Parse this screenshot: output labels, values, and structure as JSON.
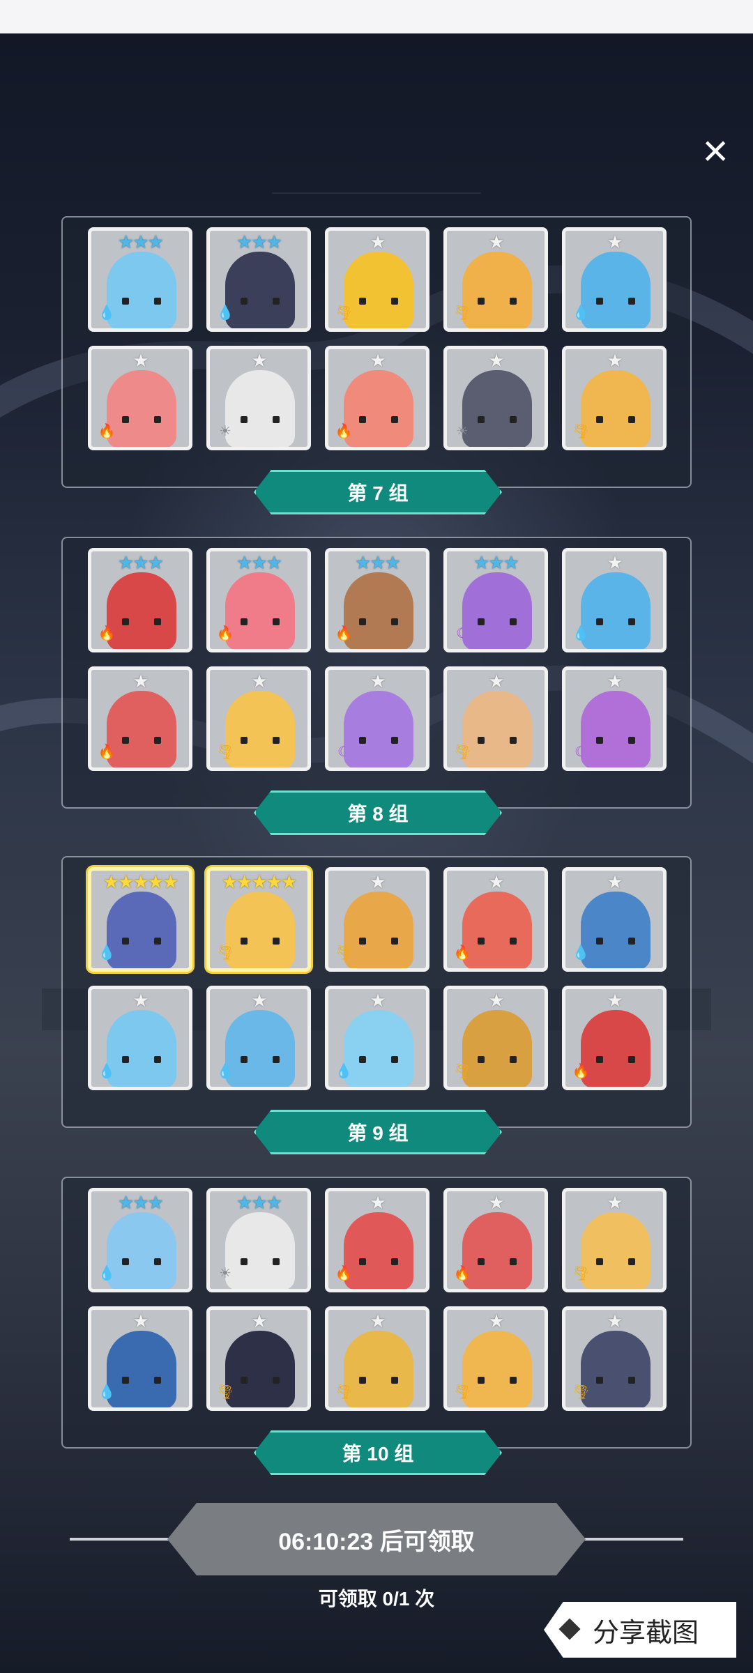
{
  "close_icon": "×",
  "groups": [
    {
      "label": "第 7 组",
      "cards": [
        {
          "stars": "★★★",
          "tier": "blue",
          "element": "water",
          "hair": "#7cc8ef"
        },
        {
          "stars": "★★★",
          "tier": "blue",
          "element": "water",
          "hair": "#3b3f5a"
        },
        {
          "stars": "★",
          "tier": "silver",
          "element": "wind",
          "hair": "#f3c232"
        },
        {
          "stars": "★",
          "tier": "silver",
          "element": "wind",
          "hair": "#f0b14a"
        },
        {
          "stars": "★",
          "tier": "silver",
          "element": "water",
          "hair": "#5ab4e8"
        },
        {
          "stars": "★",
          "tier": "silver",
          "element": "fire",
          "hair": "#ee8a8a"
        },
        {
          "stars": "★",
          "tier": "silver",
          "element": "light",
          "hair": "#e8e8e8"
        },
        {
          "stars": "★",
          "tier": "silver",
          "element": "fire",
          "hair": "#f08a7a"
        },
        {
          "stars": "★",
          "tier": "silver",
          "element": "light",
          "hair": "#5a5e70"
        },
        {
          "stars": "★",
          "tier": "silver",
          "element": "wind",
          "hair": "#f0b650"
        }
      ]
    },
    {
      "label": "第 8 组",
      "cards": [
        {
          "stars": "★★★",
          "tier": "blue",
          "element": "fire",
          "hair": "#d94848"
        },
        {
          "stars": "★★★",
          "tier": "blue",
          "element": "fire",
          "hair": "#ef7c88"
        },
        {
          "stars": "★★★",
          "tier": "blue",
          "element": "fire",
          "hair": "#b27a52"
        },
        {
          "stars": "★★★",
          "tier": "blue",
          "element": "dark",
          "hair": "#a070d8"
        },
        {
          "stars": "★",
          "tier": "silver",
          "element": "water",
          "hair": "#5ab4e8"
        },
        {
          "stars": "★",
          "tier": "silver",
          "element": "fire",
          "hair": "#e06060"
        },
        {
          "stars": "★",
          "tier": "silver",
          "element": "wind",
          "hair": "#f3c455"
        },
        {
          "stars": "★",
          "tier": "silver",
          "element": "dark",
          "hair": "#a77ee0"
        },
        {
          "stars": "★",
          "tier": "silver",
          "element": "wind",
          "hair": "#e8b888"
        },
        {
          "stars": "★",
          "tier": "silver",
          "element": "dark",
          "hair": "#b070d8"
        }
      ]
    },
    {
      "label": "第 9 组",
      "cards": [
        {
          "stars": "★★★★★",
          "tier": "gold",
          "element": "water",
          "hair": "#5a6ab8"
        },
        {
          "stars": "★★★★★",
          "tier": "gold",
          "element": "wind",
          "hair": "#f3c455"
        },
        {
          "stars": "★",
          "tier": "silver",
          "element": "wind",
          "hair": "#e8a84a"
        },
        {
          "stars": "★",
          "tier": "silver",
          "element": "fire",
          "hair": "#e86a5a"
        },
        {
          "stars": "★",
          "tier": "silver",
          "element": "water",
          "hair": "#4a86c8"
        },
        {
          "stars": "★",
          "tier": "silver",
          "element": "water",
          "hair": "#7cc8ef"
        },
        {
          "stars": "★",
          "tier": "silver",
          "element": "water",
          "hair": "#6ab8e8"
        },
        {
          "stars": "★",
          "tier": "silver",
          "element": "water",
          "hair": "#8ad0f0"
        },
        {
          "stars": "★",
          "tier": "silver",
          "element": "wind",
          "hair": "#d8a040"
        },
        {
          "stars": "★",
          "tier": "silver",
          "element": "fire",
          "hair": "#d84848"
        }
      ]
    },
    {
      "label": "第 10 组",
      "cards": [
        {
          "stars": "★★★",
          "tier": "blue",
          "element": "water",
          "hair": "#8ac8f0"
        },
        {
          "stars": "★★★",
          "tier": "blue",
          "element": "light",
          "hair": "#e8e8e8"
        },
        {
          "stars": "★",
          "tier": "silver",
          "element": "fire",
          "hair": "#e05858"
        },
        {
          "stars": "★",
          "tier": "silver",
          "element": "fire",
          "hair": "#e06060"
        },
        {
          "stars": "★",
          "tier": "silver",
          "element": "wind",
          "hair": "#f0c060"
        },
        {
          "stars": "★",
          "tier": "silver",
          "element": "water",
          "hair": "#3a6ab0"
        },
        {
          "stars": "★",
          "tier": "silver",
          "element": "wind",
          "hair": "#2e3048"
        },
        {
          "stars": "★",
          "tier": "silver",
          "element": "wind",
          "hair": "#e8b84a"
        },
        {
          "stars": "★",
          "tier": "silver",
          "element": "wind",
          "hair": "#f0b650"
        },
        {
          "stars": "★",
          "tier": "silver",
          "element": "wind",
          "hair": "#4a5070"
        }
      ]
    }
  ],
  "timer": {
    "label": "06:10:23 后可领取"
  },
  "claim": {
    "label": "可领取 0/1 次"
  },
  "share": {
    "label": "分享截图"
  },
  "element_icons": {
    "water": "💧",
    "fire": "🔥",
    "wind": "🌪",
    "light": "☀",
    "dark": "☾"
  },
  "colors": {
    "teal": "#0f8a7c",
    "gold": "#ffd83a"
  }
}
